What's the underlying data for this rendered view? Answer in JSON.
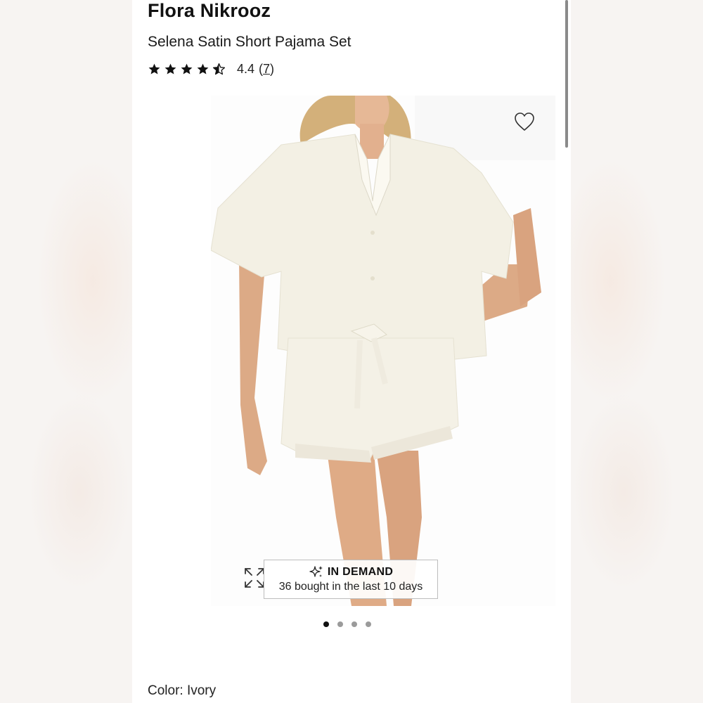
{
  "product": {
    "brand": "Flora Nikrooz",
    "name": "Selena Satin Short Pajama Set",
    "rating": {
      "value": "4.4",
      "count": "7",
      "stars": 4.4,
      "max_stars": 5
    }
  },
  "gallery": {
    "image_description": "Model wearing ivory satin short-sleeve pajama shirt and lace-trim shorts",
    "favorite_icon": "heart-outline-icon",
    "expand_icon": "expand-arrows-icon",
    "badge": {
      "icon": "sparkle-icon",
      "title": "IN DEMAND",
      "subtitle": "36 bought in the last 10 days"
    },
    "pagination": {
      "total": 4,
      "active": 1
    }
  },
  "color": {
    "label": "Color: Ivory"
  }
}
